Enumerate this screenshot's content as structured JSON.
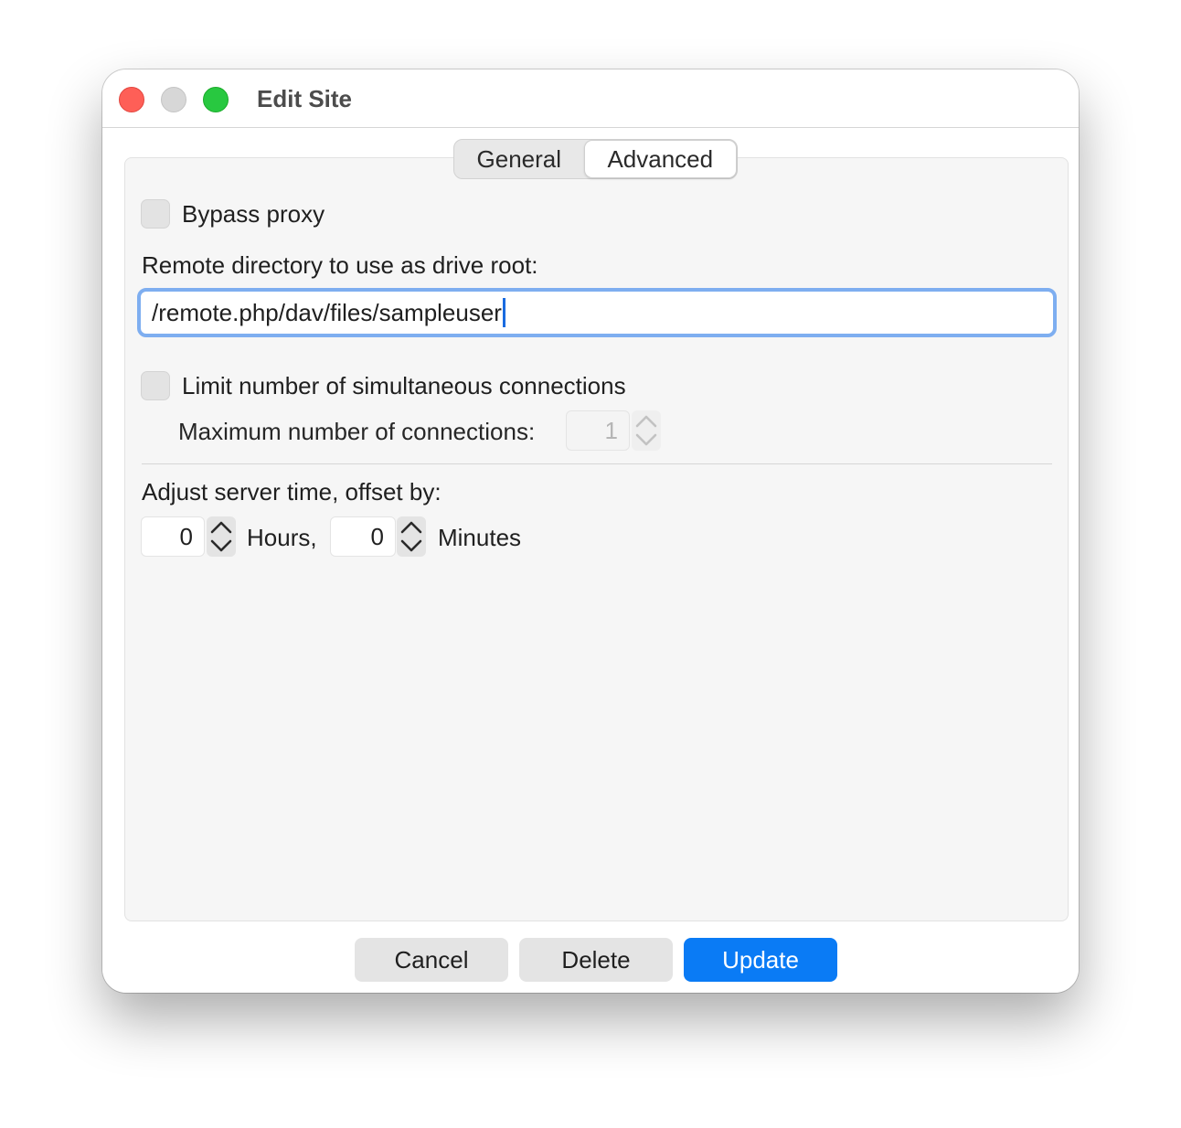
{
  "window": {
    "title": "Edit Site"
  },
  "tabs": {
    "general": "General",
    "advanced": "Advanced",
    "active": "advanced"
  },
  "advanced": {
    "bypass_proxy": {
      "label": "Bypass proxy",
      "checked": false
    },
    "remote_dir": {
      "label": "Remote directory to use as drive root:",
      "value": "/remote.php/dav/files/sampleuser"
    },
    "limit_connections": {
      "label": "Limit number of simultaneous connections",
      "checked": false
    },
    "max_connections": {
      "label": "Maximum number of connections:",
      "value": "1"
    },
    "server_time": {
      "label": "Adjust server time, offset by:",
      "hours_value": "0",
      "hours_label": "Hours,",
      "minutes_value": "0",
      "minutes_label": "Minutes"
    }
  },
  "buttons": {
    "cancel": "Cancel",
    "delete": "Delete",
    "update": "Update"
  },
  "colors": {
    "accent": "#0a7bf5",
    "focus_ring": "#7eaef0",
    "close": "#fe5f57",
    "maximize": "#28c840"
  }
}
